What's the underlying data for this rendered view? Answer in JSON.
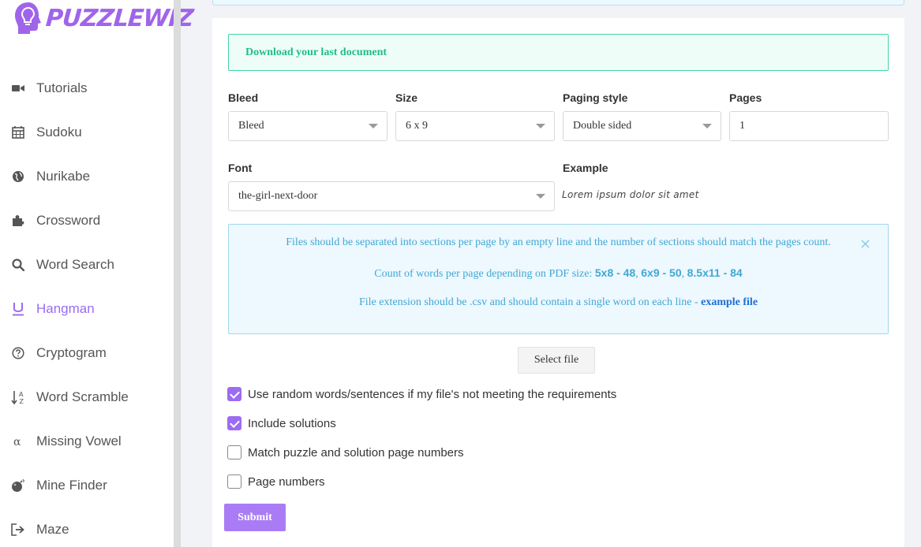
{
  "brand": {
    "name": "PuzzleWiz",
    "logo_word": "PUZZLEWIZ",
    "accent_color": "#9b6cf1"
  },
  "sidebar": {
    "items": [
      {
        "label": "Tutorials",
        "icon": "video-camera-icon",
        "active": false
      },
      {
        "label": "Sudoku",
        "icon": "calendar-grid-icon",
        "active": false
      },
      {
        "label": "Nurikabe",
        "icon": "globe-icon",
        "active": false
      },
      {
        "label": "Crossword",
        "icon": "puzzle-piece-icon",
        "active": false
      },
      {
        "label": "Word Search",
        "icon": "search-icon",
        "active": false
      },
      {
        "label": "Hangman",
        "icon": "underline-u-icon",
        "active": true
      },
      {
        "label": "Cryptogram",
        "icon": "question-circle-icon",
        "active": false
      },
      {
        "label": "Word Scramble",
        "icon": "sort-alpha-icon",
        "active": false
      },
      {
        "label": "Missing Vowel",
        "icon": "alpha-icon",
        "active": false
      },
      {
        "label": "Mine Finder",
        "icon": "bomb-icon",
        "active": false
      },
      {
        "label": "Maze",
        "icon": "sign-out-icon",
        "active": false
      }
    ]
  },
  "download": {
    "label": "Download your last document"
  },
  "form": {
    "bleed": {
      "label": "Bleed",
      "value": "Bleed"
    },
    "size": {
      "label": "Size",
      "value": "6 x 9"
    },
    "paging_style": {
      "label": "Paging style",
      "value": "Double sided"
    },
    "pages": {
      "label": "Pages",
      "value": "1"
    },
    "font": {
      "label": "Font",
      "value": "the-girl-next-door"
    },
    "example": {
      "label": "Example",
      "text": "Lorem ipsum dolor sit amet"
    }
  },
  "info": {
    "line1": "Files should be separated into sections per page by an empty line and the number of sections should match the pages count.",
    "line2_prefix": "Count of words per page depending on PDF size: ",
    "size_5x8": "5x8 - 48",
    "size_6x9": "6x9 - 50",
    "size_8_5x11": "8.5x11 - 84",
    "sep": ", ",
    "line3_prefix": "File extension should be .csv and should contain a single word on each line - ",
    "example_link": "example file",
    "close_symbol": "×"
  },
  "select_file_label": "Select file",
  "options": [
    {
      "label": "Use random words/sentences if my file's not meeting the requirements",
      "checked": true
    },
    {
      "label": "Include solutions",
      "checked": true
    },
    {
      "label": "Match puzzle and solution page numbers",
      "checked": false
    },
    {
      "label": "Page numbers",
      "checked": false
    }
  ],
  "submit_label": "Submit"
}
